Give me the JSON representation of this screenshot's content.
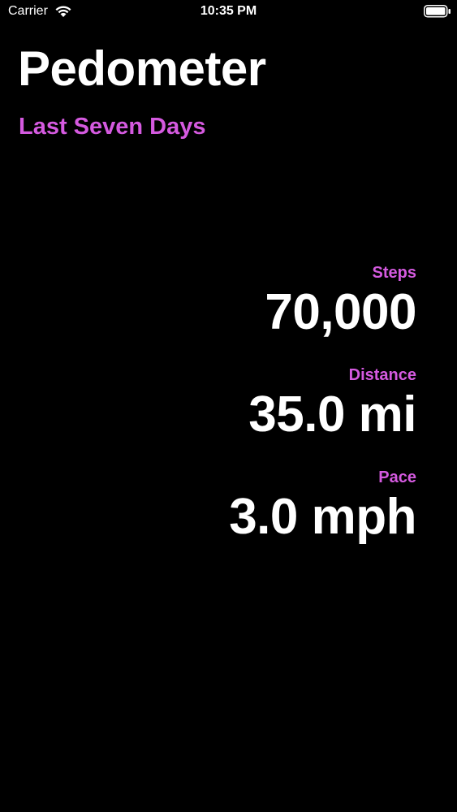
{
  "status_bar": {
    "carrier": "Carrier",
    "time": "10:35 PM",
    "wifi_icon": "wifi-icon",
    "battery_icon": "battery-icon"
  },
  "header": {
    "title": "Pedometer",
    "subtitle": "Last Seven Days"
  },
  "metrics": [
    {
      "label": "Steps",
      "value": "70,000"
    },
    {
      "label": "Distance",
      "value": "35.0 mi"
    },
    {
      "label": "Pace",
      "value": "3.0 mph"
    }
  ],
  "colors": {
    "background": "#000000",
    "accent": "#d55ae0",
    "text": "#ffffff"
  }
}
